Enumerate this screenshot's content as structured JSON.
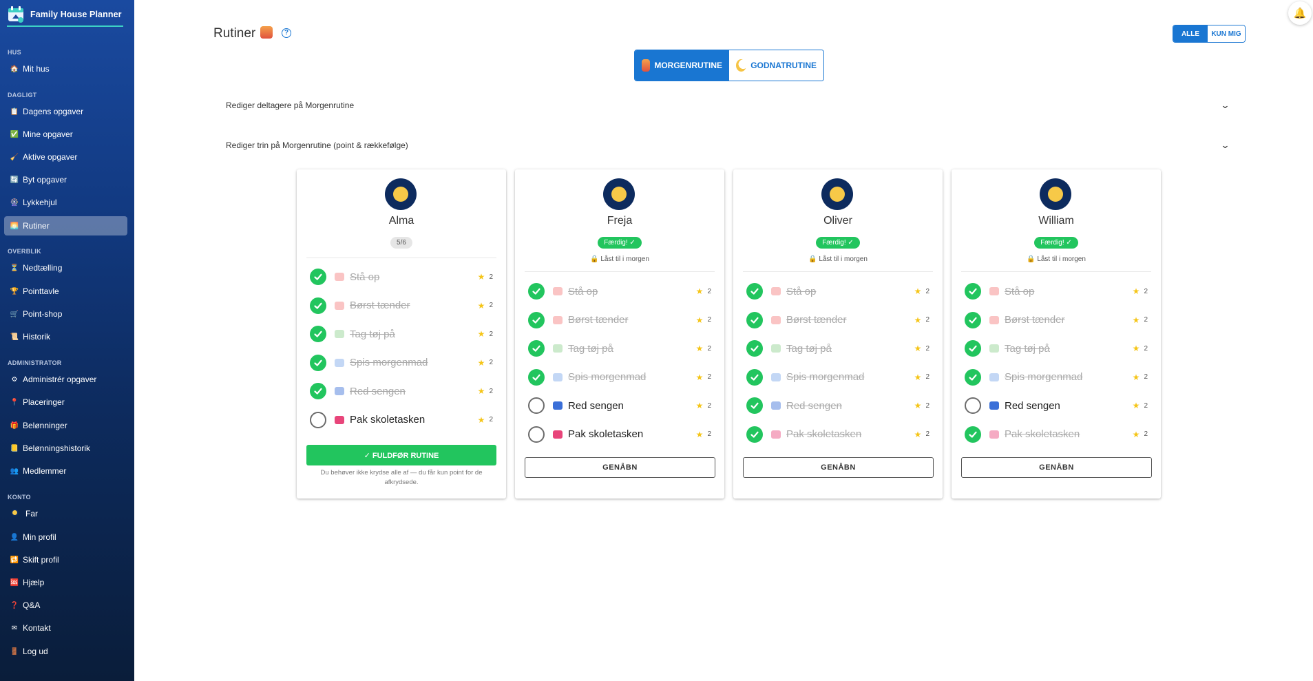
{
  "app": {
    "name": "Family House Planner"
  },
  "sidebar": {
    "sections": [
      {
        "label": "HUS",
        "items": [
          {
            "label": "Mit hus",
            "icon": "house-icon"
          }
        ]
      },
      {
        "label": "DAGLIGT",
        "items": [
          {
            "label": "Dagens opgaver",
            "icon": "notepad-icon"
          },
          {
            "label": "Mine opgaver",
            "icon": "checkbox-icon"
          },
          {
            "label": "Aktive opgaver",
            "icon": "broom-icon"
          },
          {
            "label": "Byt opgaver",
            "icon": "swap-icon"
          },
          {
            "label": "Lykkehjul",
            "icon": "wheel-icon"
          },
          {
            "label": "Rutiner",
            "icon": "sunrise-icon",
            "active": true
          }
        ]
      },
      {
        "label": "OVERBLIK",
        "items": [
          {
            "label": "Nedtælling",
            "icon": "hourglass-icon"
          },
          {
            "label": "Pointtavle",
            "icon": "trophy-icon"
          },
          {
            "label": "Point-shop",
            "icon": "cart-icon"
          },
          {
            "label": "Historik",
            "icon": "scroll-icon"
          }
        ]
      },
      {
        "label": "ADMINISTRATOR",
        "items": [
          {
            "label": "Administrér opgaver",
            "icon": "gear-icon"
          },
          {
            "label": "Placeringer",
            "icon": "pin-icon"
          },
          {
            "label": "Belønninger",
            "icon": "gift-icon"
          },
          {
            "label": "Belønningshistorik",
            "icon": "ledger-icon"
          },
          {
            "label": "Medlemmer",
            "icon": "people-icon"
          }
        ]
      },
      {
        "label": "KONTO",
        "items": [
          {
            "label": "Far",
            "icon": "avatar-icon"
          },
          {
            "label": "Min profil",
            "icon": "person-icon"
          },
          {
            "label": "Skift profil",
            "icon": "switch-icon"
          },
          {
            "label": "Hjælp",
            "icon": "sos-icon"
          },
          {
            "label": "Q&A",
            "icon": "question-icon"
          },
          {
            "label": "Kontakt",
            "icon": "envelope-icon"
          },
          {
            "label": "Log ud",
            "icon": "door-icon"
          }
        ]
      }
    ]
  },
  "header": {
    "title": "Rutiner",
    "filter": {
      "all": "ALLE",
      "only_me": "KUN MIG"
    },
    "tabs": {
      "morning": "MORGENRUTINE",
      "night": "GODNATRUTINE"
    },
    "accordion_participants": "Rediger deltagere på Morgenrutine",
    "accordion_steps": "Rediger trin på Morgenrutine (point & rækkefølge)"
  },
  "cards": [
    {
      "name": "Alma",
      "progress": "5/6",
      "steps": [
        {
          "label": "Stå op",
          "points": "2",
          "done": true,
          "color": "#f47c7c"
        },
        {
          "label": "Børst tænder",
          "points": "2",
          "done": true,
          "color": "#f47c7c"
        },
        {
          "label": "Tag tøj på",
          "points": "2",
          "done": true,
          "color": "#8fd18f"
        },
        {
          "label": "Spis morgenmad",
          "points": "2",
          "done": true,
          "color": "#7aa7e8"
        },
        {
          "label": "Red sengen",
          "points": "2",
          "done": true,
          "color": "#3a6fd8"
        },
        {
          "label": "Pak skoletasken",
          "points": "2",
          "done": false,
          "color": "#e8457a"
        }
      ],
      "complete_label": "✓ FULDFØR RUTINE",
      "hint": "Du behøver ikke krydse alle af — du får kun point for de afkrydsede."
    },
    {
      "name": "Freja",
      "status": "Færdig! ✓",
      "locked": "Låst til i morgen",
      "steps": [
        {
          "label": "Stå op",
          "points": "2",
          "done": true,
          "color": "#f47c7c"
        },
        {
          "label": "Børst tænder",
          "points": "2",
          "done": true,
          "color": "#f47c7c"
        },
        {
          "label": "Tag tøj på",
          "points": "2",
          "done": true,
          "color": "#8fd18f"
        },
        {
          "label": "Spis morgenmad",
          "points": "2",
          "done": true,
          "color": "#7aa7e8"
        },
        {
          "label": "Red sengen",
          "points": "2",
          "done": false,
          "color": "#3a6fd8"
        },
        {
          "label": "Pak skoletasken",
          "points": "2",
          "done": false,
          "color": "#e8457a"
        }
      ],
      "reopen_label": "GENÅBN"
    },
    {
      "name": "Oliver",
      "status": "Færdig! ✓",
      "locked": "Låst til i morgen",
      "steps": [
        {
          "label": "Stå op",
          "points": "2",
          "done": true,
          "color": "#f47c7c"
        },
        {
          "label": "Børst tænder",
          "points": "2",
          "done": true,
          "color": "#f47c7c"
        },
        {
          "label": "Tag tøj på",
          "points": "2",
          "done": true,
          "color": "#8fd18f"
        },
        {
          "label": "Spis morgenmad",
          "points": "2",
          "done": true,
          "color": "#7aa7e8"
        },
        {
          "label": "Red sengen",
          "points": "2",
          "done": true,
          "color": "#3a6fd8"
        },
        {
          "label": "Pak skoletasken",
          "points": "2",
          "done": true,
          "color": "#e8457a"
        }
      ],
      "reopen_label": "GENÅBN"
    },
    {
      "name": "William",
      "status": "Færdig! ✓",
      "locked": "Låst til i morgen",
      "steps": [
        {
          "label": "Stå op",
          "points": "2",
          "done": true,
          "color": "#f47c7c"
        },
        {
          "label": "Børst tænder",
          "points": "2",
          "done": true,
          "color": "#f47c7c"
        },
        {
          "label": "Tag tøj på",
          "points": "2",
          "done": true,
          "color": "#8fd18f"
        },
        {
          "label": "Spis morgenmad",
          "points": "2",
          "done": true,
          "color": "#7aa7e8"
        },
        {
          "label": "Red sengen",
          "points": "2",
          "done": false,
          "color": "#3a6fd8"
        },
        {
          "label": "Pak skoletasken",
          "points": "2",
          "done": true,
          "color": "#e8457a"
        }
      ],
      "reopen_label": "GENÅBN"
    }
  ],
  "colors": {
    "primary": "#1976d2",
    "success": "#22c55e",
    "sidebar_top": "#1a4aa0",
    "sidebar_bottom": "#0a1d3a"
  }
}
